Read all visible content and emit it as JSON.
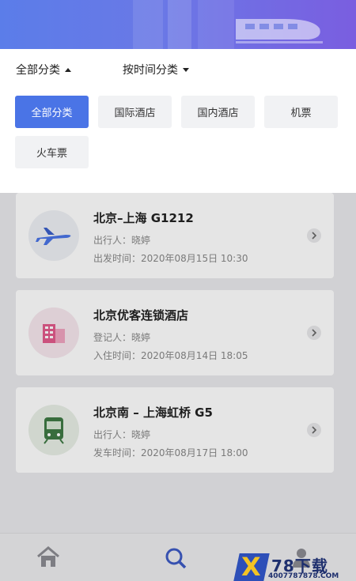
{
  "sort": {
    "category_label": "全部分类",
    "time_label": "按时间分类"
  },
  "filters": [
    {
      "label": "全部分类",
      "active": true
    },
    {
      "label": "国际酒店",
      "active": false
    },
    {
      "label": "国内酒店",
      "active": false
    },
    {
      "label": "机票",
      "active": false
    },
    {
      "label": "火车票",
      "active": false
    }
  ],
  "orders": [
    {
      "icon": "airplane-icon",
      "title": "北京–上海 G1212",
      "line1": "出行人：晓婷",
      "line2": "出发时间：2020年08月15日 10:30"
    },
    {
      "icon": "hotel-icon",
      "title": "北京优客连锁酒店",
      "line1": "登记人：晓婷",
      "line2": "入住时间：2020年08月14日 18:05"
    },
    {
      "icon": "train-icon",
      "title": "北京南 – 上海虹桥 G5",
      "line1": "出行人：晓婷",
      "line2": "发车时间：2020年08月17日 18:00"
    }
  ],
  "tabs": [
    {
      "icon": "home-icon"
    },
    {
      "icon": "search-icon"
    },
    {
      "icon": "profile-icon"
    }
  ],
  "watermark": {
    "mark": "X",
    "brand": "78下载",
    "url": "4007787878.COM"
  },
  "colors": {
    "accent": "#4a74e6",
    "banner_start": "#5b7de9",
    "banner_end": "#7a5ee0"
  }
}
